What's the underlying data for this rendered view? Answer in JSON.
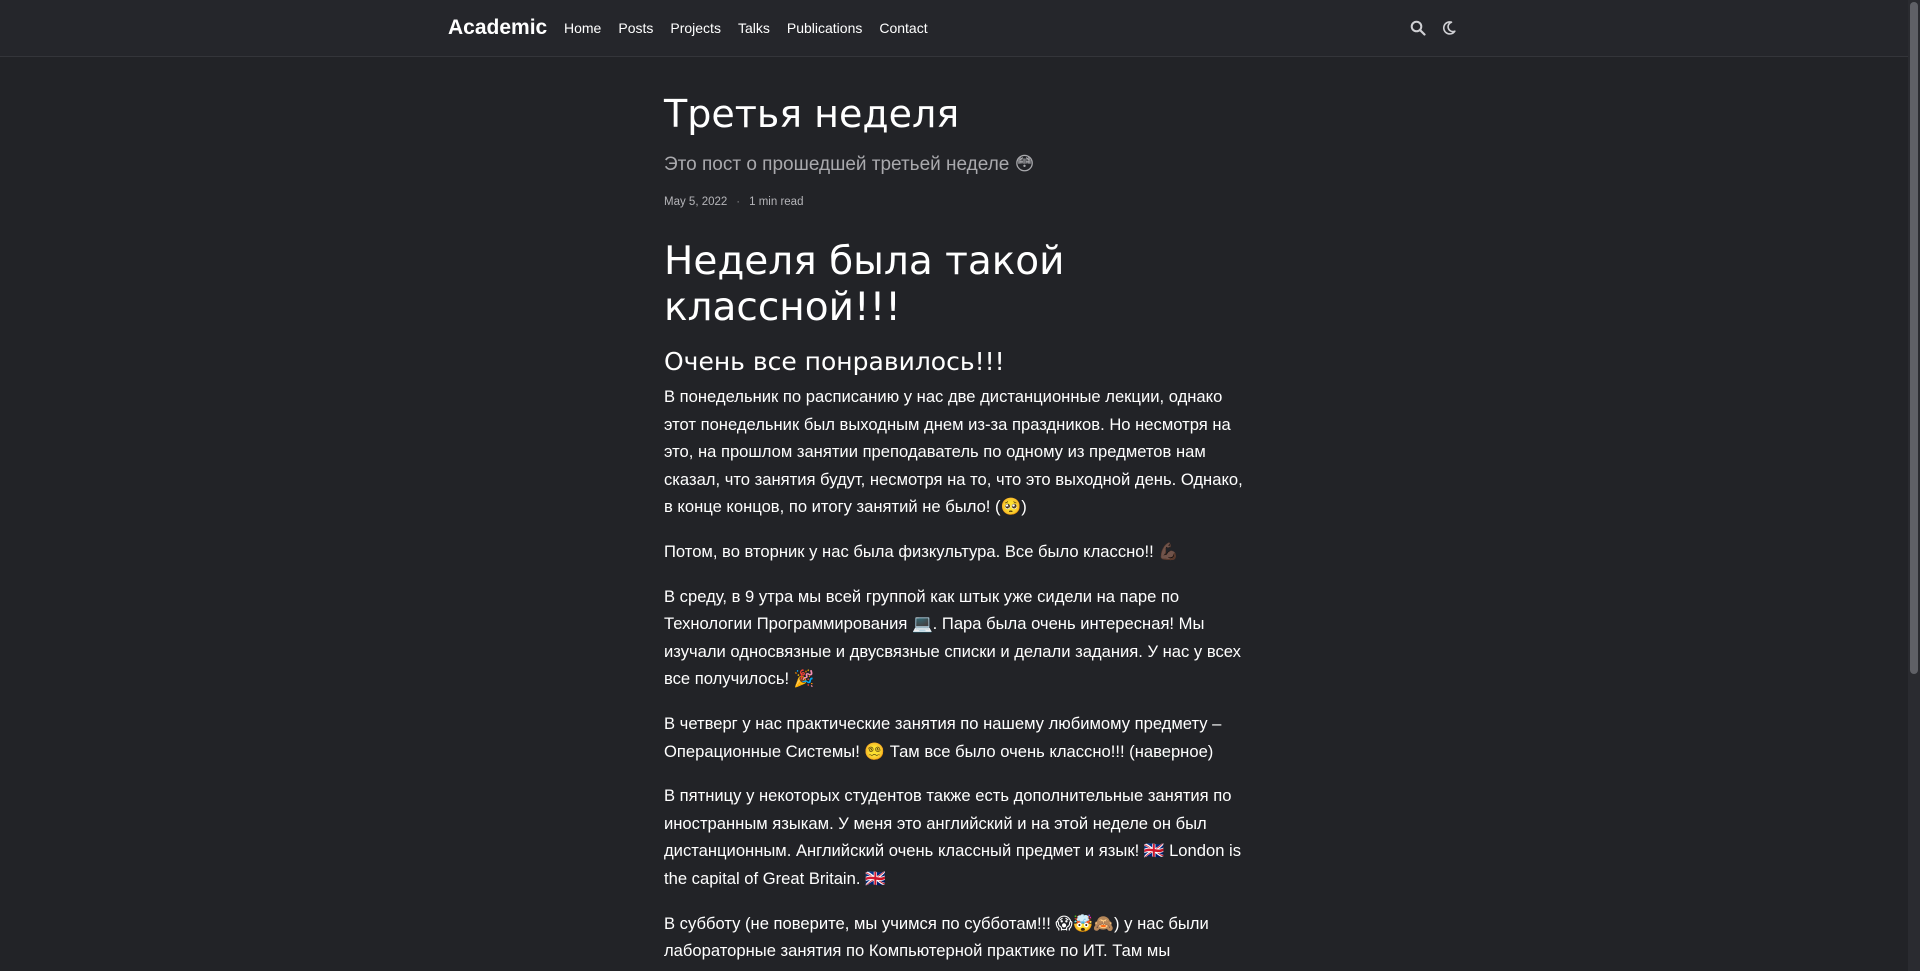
{
  "navbar": {
    "brand": "Academic",
    "links": [
      "Home",
      "Posts",
      "Projects",
      "Talks",
      "Publications",
      "Contact"
    ],
    "icons": [
      "search-icon",
      "moon-icon"
    ]
  },
  "post": {
    "title": "Третья неделя",
    "subtitle": "Это пост о прошедшей третьей неделе 😳",
    "date": "May 5, 2022",
    "separator": "·",
    "read_time": "1 min read"
  },
  "article": {
    "heading1": "Неделя была такой классной!!!",
    "heading2": "Очень все понравилось!!!",
    "paragraphs": [
      "В понедельник по расписанию у нас две дистанционные лекции, однако этот понедельник был выходным днем из-за праздников. Но несмотря на это, на прошлом занятии преподаватель по одному из предметов нам сказал, что занятия будут, несмотря на то, что это выходной день. Однако, в конце концов, по итогу занятий не было! (🥺)",
      "Потом, во вторник у нас была физкультура. Все было классно!! 💪🏿",
      "В среду, в 9 утра мы всей группой как штык уже сидели на паре по Технологии Программирования 💻. Пара была очень интересная! Мы изучали односвязные и двусвязные списки и делали задания. У нас у всех все получилось! 🎉",
      "В четверг у нас практические занятия по нашему любимому предмету – Операционные Системы! 😵‍💫 Там все было очень классно!!! (наверное)",
      "В пятницу у некоторых студентов также есть дополнительные занятия по иностранным языкам. У меня это английский и на этой неделе он был дистанционным. Английский очень классный предмет и язык! 🇬🇧 London is the capital of Great Britain. 🇬🇧",
      "В субботу (не поверите, мы учимся по субботам!!! 😱🤯🙈) у нас были лабораторные занятия по Компьютерной практике по ИТ. Там мы"
    ]
  },
  "colors": {
    "background": "#222327",
    "navbar": "#25262b",
    "text": "#ffffff",
    "muted": "#a9a9ad"
  }
}
